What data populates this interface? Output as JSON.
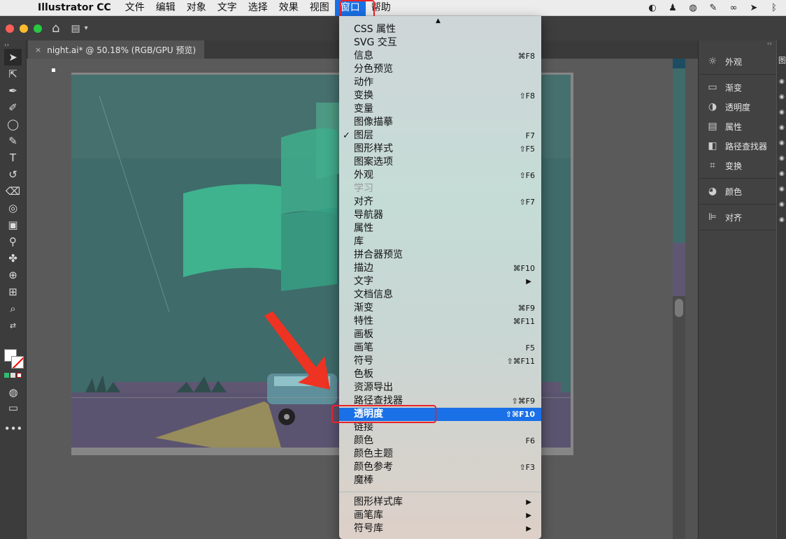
{
  "menubar": {
    "app_name": "Illustrator CC",
    "items": [
      "文件",
      "编辑",
      "对象",
      "文字",
      "选择",
      "效果",
      "视图",
      "窗口",
      "帮助"
    ],
    "active_item": "窗口",
    "tray_icons": [
      "moon-app-icon",
      "qq-icon",
      "wechat-icon",
      "feather-icon",
      "creative-cloud-icon",
      "send-icon",
      "bluetooth-icon"
    ]
  },
  "document": {
    "tab_title": "night.ai* @ 50.18% (RGB/GPU 预览)",
    "close_glyph": "×"
  },
  "window_menu": {
    "items": [
      {
        "label": "CSS 属性",
        "shortcut": "",
        "checked": false,
        "disabled": false,
        "submenu": false
      },
      {
        "label": "SVG 交互",
        "shortcut": "",
        "checked": false,
        "disabled": false,
        "submenu": false
      },
      {
        "label": "信息",
        "shortcut": "⌘F8",
        "checked": false,
        "disabled": false,
        "submenu": false
      },
      {
        "label": "分色预览",
        "shortcut": "",
        "checked": false,
        "disabled": false,
        "submenu": false
      },
      {
        "label": "动作",
        "shortcut": "",
        "checked": false,
        "disabled": false,
        "submenu": false
      },
      {
        "label": "变换",
        "shortcut": "⇧F8",
        "checked": false,
        "disabled": false,
        "submenu": false
      },
      {
        "label": "变量",
        "shortcut": "",
        "checked": false,
        "disabled": false,
        "submenu": false
      },
      {
        "label": "图像描摹",
        "shortcut": "",
        "checked": false,
        "disabled": false,
        "submenu": false
      },
      {
        "label": "图层",
        "shortcut": "F7",
        "checked": true,
        "disabled": false,
        "submenu": false
      },
      {
        "label": "图形样式",
        "shortcut": "⇧F5",
        "checked": false,
        "disabled": false,
        "submenu": false
      },
      {
        "label": "图案选项",
        "shortcut": "",
        "checked": false,
        "disabled": false,
        "submenu": false
      },
      {
        "label": "外观",
        "shortcut": "⇧F6",
        "checked": false,
        "disabled": false,
        "submenu": false
      },
      {
        "label": "学习",
        "shortcut": "",
        "checked": false,
        "disabled": true,
        "submenu": false
      },
      {
        "label": "对齐",
        "shortcut": "⇧F7",
        "checked": false,
        "disabled": false,
        "submenu": false
      },
      {
        "label": "导航器",
        "shortcut": "",
        "checked": false,
        "disabled": false,
        "submenu": false
      },
      {
        "label": "属性",
        "shortcut": "",
        "checked": false,
        "disabled": false,
        "submenu": false
      },
      {
        "label": "库",
        "shortcut": "",
        "checked": false,
        "disabled": false,
        "submenu": false
      },
      {
        "label": "拼合器预览",
        "shortcut": "",
        "checked": false,
        "disabled": false,
        "submenu": false
      },
      {
        "label": "描边",
        "shortcut": "⌘F10",
        "checked": false,
        "disabled": false,
        "submenu": false
      },
      {
        "label": "文字",
        "shortcut": "",
        "checked": false,
        "disabled": false,
        "submenu": true
      },
      {
        "label": "文档信息",
        "shortcut": "",
        "checked": false,
        "disabled": false,
        "submenu": false
      },
      {
        "label": "渐变",
        "shortcut": "⌘F9",
        "checked": false,
        "disabled": false,
        "submenu": false
      },
      {
        "label": "特性",
        "shortcut": "⌘F11",
        "checked": false,
        "disabled": false,
        "submenu": false
      },
      {
        "label": "画板",
        "shortcut": "",
        "checked": false,
        "disabled": false,
        "submenu": false
      },
      {
        "label": "画笔",
        "shortcut": "F5",
        "checked": false,
        "disabled": false,
        "submenu": false
      },
      {
        "label": "符号",
        "shortcut": "⇧⌘F11",
        "checked": false,
        "disabled": false,
        "submenu": false
      },
      {
        "label": "色板",
        "shortcut": "",
        "checked": false,
        "disabled": false,
        "submenu": false
      },
      {
        "label": "资源导出",
        "shortcut": "",
        "checked": false,
        "disabled": false,
        "submenu": false
      },
      {
        "label": "路径查找器",
        "shortcut": "⇧⌘F9",
        "checked": false,
        "disabled": false,
        "submenu": false
      },
      {
        "label": "透明度",
        "shortcut": "⇧⌘F10",
        "checked": false,
        "disabled": false,
        "submenu": false,
        "highlighted": true
      },
      {
        "label": "链接",
        "shortcut": "",
        "checked": false,
        "disabled": false,
        "submenu": false
      },
      {
        "label": "颜色",
        "shortcut": "F6",
        "checked": false,
        "disabled": false,
        "submenu": false
      },
      {
        "label": "颜色主题",
        "shortcut": "",
        "checked": false,
        "disabled": false,
        "submenu": false
      },
      {
        "label": "颜色参考",
        "shortcut": "⇧F3",
        "checked": false,
        "disabled": false,
        "submenu": false
      },
      {
        "label": "魔棒",
        "shortcut": "",
        "checked": false,
        "disabled": false,
        "submenu": false
      }
    ],
    "library_items": [
      {
        "label": "图形样式库",
        "submenu": true
      },
      {
        "label": "画笔库",
        "submenu": true
      },
      {
        "label": "符号库",
        "submenu": true
      }
    ],
    "check_glyph": "✓",
    "submenu_glyph": "▶",
    "scroll_up_glyph": "▲"
  },
  "right_panel": {
    "group1": [
      {
        "label": "外观",
        "icon": "sun-icon",
        "glyph": "☼"
      }
    ],
    "group2": [
      {
        "label": "渐变",
        "icon": "gradient-icon",
        "glyph": "▭"
      },
      {
        "label": "透明度",
        "icon": "transparency-icon",
        "glyph": "◑"
      },
      {
        "label": "属性",
        "icon": "properties-icon",
        "glyph": "▤"
      },
      {
        "label": "路径查找器",
        "icon": "pathfinder-icon",
        "glyph": "◧"
      },
      {
        "label": "变换",
        "icon": "transform-icon",
        "glyph": "⌗"
      }
    ],
    "group3": [
      {
        "label": "颜色",
        "icon": "palette-icon",
        "glyph": "◕"
      }
    ],
    "group4": [
      {
        "label": "对齐",
        "icon": "align-icon",
        "glyph": "⊫"
      }
    ],
    "partial_label": "图"
  },
  "colors": {
    "menu_highlight": "#1a70e6",
    "annotation_red": "#e8222a",
    "aurora": "#3fbf94",
    "sky": "#3f6b6a",
    "ground": "#5f5672",
    "headlight": "#c9b94a"
  }
}
